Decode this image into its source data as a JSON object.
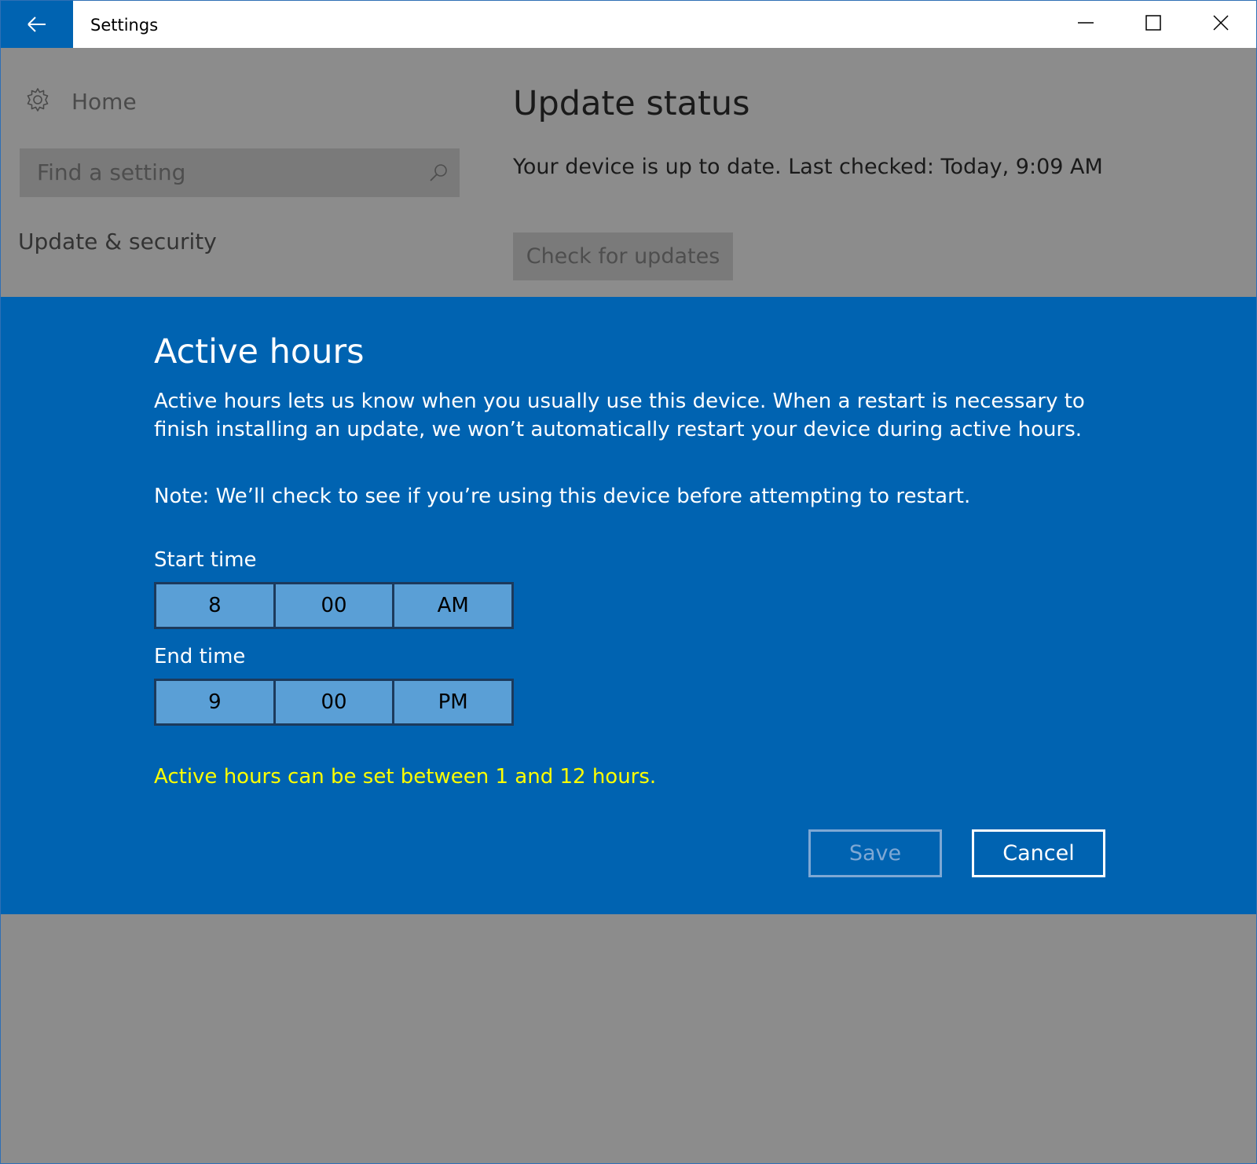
{
  "window": {
    "title": "Settings"
  },
  "sidebar": {
    "home_label": "Home",
    "search_placeholder": "Find a setting",
    "category": "Update & security"
  },
  "main": {
    "section_title": "Update status",
    "status_text": "Your device is up to date. Last checked: Today, 9:09 AM",
    "check_button": "Check for updates"
  },
  "dialog": {
    "title": "Active hours",
    "description": "Active hours lets us know when you usually use this device. When a restart is necessary to finish installing an update, we won’t automatically restart your device during active hours.",
    "note": "Note: We’ll check to see if you’re using this device before attempting to restart.",
    "start_label": "Start time",
    "start": {
      "hour": "8",
      "minute": "00",
      "period": "AM"
    },
    "end_label": "End time",
    "end": {
      "hour": "9",
      "minute": "00",
      "period": "PM"
    },
    "warning": "Active hours can be set between 1 and 12 hours.",
    "save_label": "Save",
    "cancel_label": "Cancel"
  },
  "colors": {
    "accent": "#0063b1",
    "overlay": "#8c8c8c",
    "warning": "#ffff00"
  },
  "icons": {
    "back": "back-arrow-icon",
    "minimize": "minimize-icon",
    "maximize": "maximize-icon",
    "close": "close-icon",
    "home": "gear-icon",
    "search": "search-icon"
  }
}
